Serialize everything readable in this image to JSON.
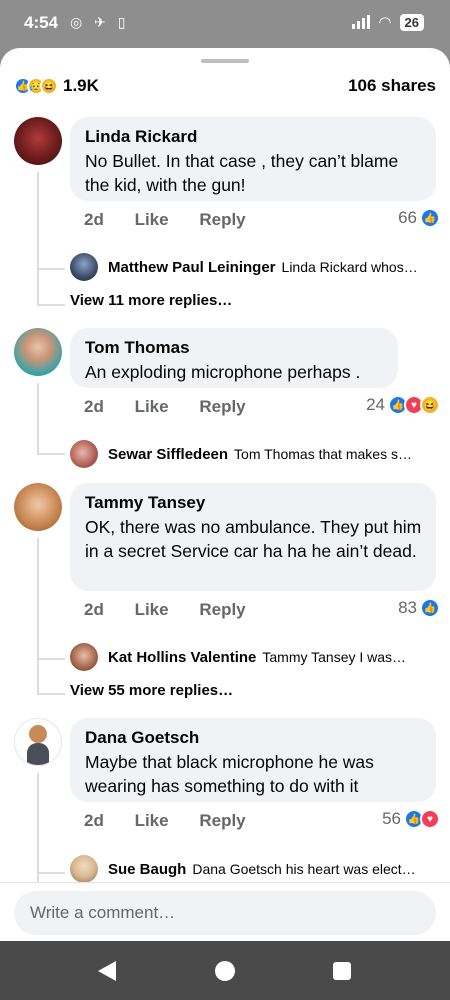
{
  "status_bar": {
    "time": "4:54",
    "battery": "26"
  },
  "post_summary": {
    "reaction_count": "1.9K",
    "shares": "106 shares",
    "reaction_icons": [
      "like-icon",
      "sad-icon",
      "haha-icon"
    ]
  },
  "comments": [
    {
      "author": "Linda Rickard",
      "text": "No Bullet.  In that case , they can’t blame the kid, with the gun!",
      "time": "2d",
      "like_label": "Like",
      "reply_label": "Reply",
      "reaction_count": "66",
      "reply": {
        "author": "Matthew Paul Leininger",
        "text": "Linda Rickard whos…"
      },
      "view_more": "View 11 more replies…"
    },
    {
      "author": "Tom Thomas",
      "text": "An exploding microphone perhaps .",
      "time": "2d",
      "like_label": "Like",
      "reply_label": "Reply",
      "reaction_count": "24",
      "reply": {
        "author": "Sewar Siffledeen",
        "text": "Tom Thomas that makes s…"
      }
    },
    {
      "author": "Tammy Tansey",
      "text": "OK, there was no ambulance. They put him in a secret Service car ha ha he ain’t dead.",
      "time": "2d",
      "like_label": "Like",
      "reply_label": "Reply",
      "reaction_count": "83",
      "reply": {
        "author": "Kat Hollins Valentine",
        "text": "Tammy Tansey  I was…"
      },
      "view_more": "View 55 more replies…"
    },
    {
      "author": "Dana Goetsch",
      "text": "Maybe that black microphone he was wearing has something to do with it",
      "time": "2d",
      "like_label": "Like",
      "reply_label": "Reply",
      "reaction_count": "56",
      "reply": {
        "author": "Sue Baugh",
        "text": "Dana Goetsch his heart was elect…"
      }
    }
  ],
  "composer": {
    "placeholder": "Write a comment…"
  },
  "colors": {
    "like": "#1877f2",
    "love": "#f33e58",
    "haha": "#f7b125",
    "bubble": "#f0f2f5",
    "meta": "#65676b"
  }
}
